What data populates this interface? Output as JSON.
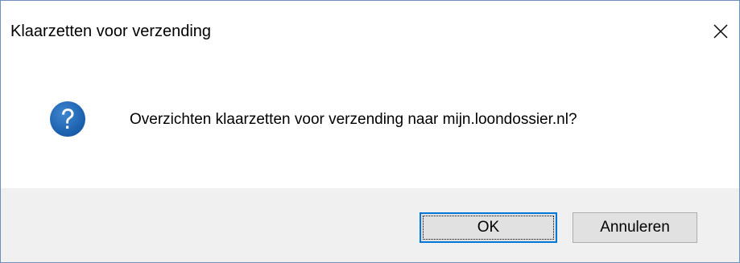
{
  "window": {
    "title": "Klaarzetten voor verzending",
    "close_icon": "close-icon"
  },
  "message": {
    "icon": "question-icon",
    "text": "Overzichten klaarzetten voor verzending naar mijn.loondossier.nl?"
  },
  "buttons": {
    "ok_label": "OK",
    "cancel_label": "Annuleren"
  },
  "colors": {
    "icon_blue": "#1a62b0",
    "focus_border": "#0078d7",
    "footer_bg": "#f0f0f0",
    "button_bg": "#e1e1e1"
  }
}
